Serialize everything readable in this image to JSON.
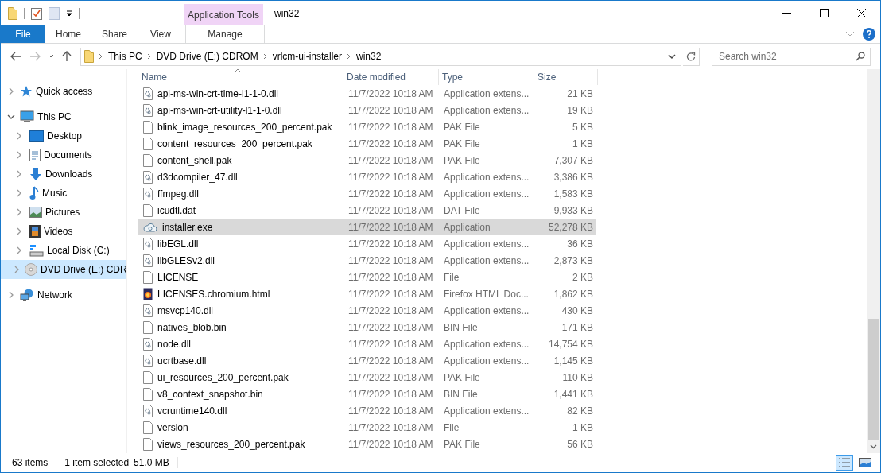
{
  "window": {
    "title": "win32",
    "contextual_tab": "Application Tools"
  },
  "ribbon_tabs": [
    {
      "label": "File",
      "kind": "file"
    },
    {
      "label": "Home",
      "kind": "normal"
    },
    {
      "label": "Share",
      "kind": "normal"
    },
    {
      "label": "View",
      "kind": "normal"
    },
    {
      "label": "Manage",
      "kind": "contextual"
    }
  ],
  "address": {
    "crumbs": [
      "This PC",
      "DVD Drive (E:) CDROM",
      "vrlcm-ui-installer",
      "win32"
    ]
  },
  "search": {
    "placeholder": "Search win32"
  },
  "nav": [
    {
      "label": "Quick access",
      "kind": "star",
      "expanded": false,
      "selected": false
    },
    {
      "label": "This PC",
      "kind": "computer",
      "expanded": true,
      "selected": false,
      "children": [
        {
          "label": "Desktop",
          "kind": "desktop",
          "expanded": false,
          "selected": false
        },
        {
          "label": "Documents",
          "kind": "documents",
          "expanded": false,
          "selected": false
        },
        {
          "label": "Downloads",
          "kind": "downloads",
          "expanded": false,
          "selected": false
        },
        {
          "label": "Music",
          "kind": "music",
          "expanded": false,
          "selected": false
        },
        {
          "label": "Pictures",
          "kind": "pictures",
          "expanded": false,
          "selected": false
        },
        {
          "label": "Videos",
          "kind": "videos",
          "expanded": false,
          "selected": false
        },
        {
          "label": "Local Disk (C:)",
          "kind": "disk",
          "expanded": false,
          "selected": false
        },
        {
          "label": "DVD Drive (E:) CDR",
          "kind": "dvd",
          "expanded": false,
          "selected": true
        }
      ]
    },
    {
      "label": "Network",
      "kind": "network",
      "expanded": false,
      "selected": false
    }
  ],
  "columns": [
    "Name",
    "Date modified",
    "Type",
    "Size"
  ],
  "files": [
    {
      "name": "api-ms-win-crt-time-l1-1-0.dll",
      "date": "11/7/2022 10:18 AM",
      "type": "Application extens...",
      "size": "21 KB",
      "kind": "dll",
      "selected": false
    },
    {
      "name": "api-ms-win-crt-utility-l1-1-0.dll",
      "date": "11/7/2022 10:18 AM",
      "type": "Application extens...",
      "size": "19 KB",
      "kind": "dll",
      "selected": false
    },
    {
      "name": "blink_image_resources_200_percent.pak",
      "date": "11/7/2022 10:18 AM",
      "type": "PAK File",
      "size": "5 KB",
      "kind": "file",
      "selected": false
    },
    {
      "name": "content_resources_200_percent.pak",
      "date": "11/7/2022 10:18 AM",
      "type": "PAK File",
      "size": "1 KB",
      "kind": "file",
      "selected": false
    },
    {
      "name": "content_shell.pak",
      "date": "11/7/2022 10:18 AM",
      "type": "PAK File",
      "size": "7,307 KB",
      "kind": "file",
      "selected": false
    },
    {
      "name": "d3dcompiler_47.dll",
      "date": "11/7/2022 10:18 AM",
      "type": "Application extens...",
      "size": "3,386 KB",
      "kind": "dll",
      "selected": false
    },
    {
      "name": "ffmpeg.dll",
      "date": "11/7/2022 10:18 AM",
      "type": "Application extens...",
      "size": "1,583 KB",
      "kind": "dll",
      "selected": false
    },
    {
      "name": "icudtl.dat",
      "date": "11/7/2022 10:18 AM",
      "type": "DAT File",
      "size": "9,933 KB",
      "kind": "file",
      "selected": false
    },
    {
      "name": "installer.exe",
      "date": "11/7/2022 10:18 AM",
      "type": "Application",
      "size": "52,278 KB",
      "kind": "exe",
      "selected": true
    },
    {
      "name": "libEGL.dll",
      "date": "11/7/2022 10:18 AM",
      "type": "Application extens...",
      "size": "36 KB",
      "kind": "dll",
      "selected": false
    },
    {
      "name": "libGLESv2.dll",
      "date": "11/7/2022 10:18 AM",
      "type": "Application extens...",
      "size": "2,873 KB",
      "kind": "dll",
      "selected": false
    },
    {
      "name": "LICENSE",
      "date": "11/7/2022 10:18 AM",
      "type": "File",
      "size": "2 KB",
      "kind": "file",
      "selected": false
    },
    {
      "name": "LICENSES.chromium.html",
      "date": "11/7/2022 10:18 AM",
      "type": "Firefox HTML Doc...",
      "size": "1,862 KB",
      "kind": "html",
      "selected": false
    },
    {
      "name": "msvcp140.dll",
      "date": "11/7/2022 10:18 AM",
      "type": "Application extens...",
      "size": "430 KB",
      "kind": "dll",
      "selected": false
    },
    {
      "name": "natives_blob.bin",
      "date": "11/7/2022 10:18 AM",
      "type": "BIN File",
      "size": "171 KB",
      "kind": "file",
      "selected": false
    },
    {
      "name": "node.dll",
      "date": "11/7/2022 10:18 AM",
      "type": "Application extens...",
      "size": "14,754 KB",
      "kind": "dll",
      "selected": false
    },
    {
      "name": "ucrtbase.dll",
      "date": "11/7/2022 10:18 AM",
      "type": "Application extens...",
      "size": "1,145 KB",
      "kind": "dll",
      "selected": false
    },
    {
      "name": "ui_resources_200_percent.pak",
      "date": "11/7/2022 10:18 AM",
      "type": "PAK File",
      "size": "110 KB",
      "kind": "file",
      "selected": false
    },
    {
      "name": "v8_context_snapshot.bin",
      "date": "11/7/2022 10:18 AM",
      "type": "BIN File",
      "size": "1,441 KB",
      "kind": "file",
      "selected": false
    },
    {
      "name": "vcruntime140.dll",
      "date": "11/7/2022 10:18 AM",
      "type": "Application extens...",
      "size": "82 KB",
      "kind": "dll",
      "selected": false
    },
    {
      "name": "version",
      "date": "11/7/2022 10:18 AM",
      "type": "File",
      "size": "1 KB",
      "kind": "file",
      "selected": false
    },
    {
      "name": "views_resources_200_percent.pak",
      "date": "11/7/2022 10:18 AM",
      "type": "PAK File",
      "size": "56 KB",
      "kind": "file",
      "selected": false
    }
  ],
  "status": {
    "count": "63 items",
    "selection": "1 item selected",
    "selection_size": "51.0 MB"
  }
}
